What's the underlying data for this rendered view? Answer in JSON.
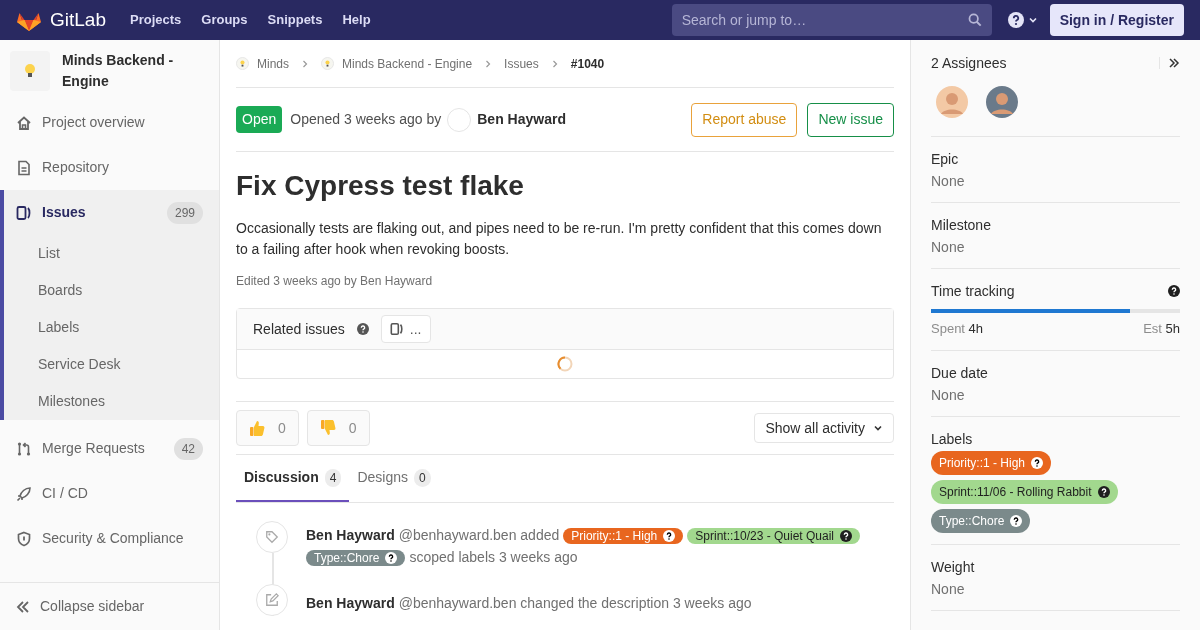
{
  "top_nav": {
    "brand": "GitLab",
    "links": [
      "Projects",
      "Groups",
      "Snippets",
      "Help"
    ],
    "search": {
      "placeholder": "Search or jump to…"
    },
    "sign_in": "Sign in / Register"
  },
  "sidebar": {
    "project": "Minds Backend - Engine",
    "items": [
      {
        "label": "Project overview",
        "selected": false
      },
      {
        "label": "Repository",
        "selected": false
      },
      {
        "label": "Issues",
        "count": "299",
        "selected": true,
        "children": [
          {
            "label": "List",
            "selected": false
          },
          {
            "label": "Boards",
            "selected": false
          },
          {
            "label": "Labels",
            "selected": false
          },
          {
            "label": "Service Desk",
            "selected": false
          },
          {
            "label": "Milestones",
            "selected": false
          }
        ]
      },
      {
        "label": "Merge Requests",
        "count": "42",
        "selected": false
      },
      {
        "label": "CI / CD",
        "selected": false
      },
      {
        "label": "Security & Compliance",
        "selected": false
      }
    ],
    "collapse": "Collapse sidebar"
  },
  "breadcrumb": [
    "Minds",
    "Minds Backend - Engine",
    "Issues",
    "#1040"
  ],
  "issue": {
    "status": "Open",
    "opened": "Opened 3 weeks ago by",
    "author": "Ben Hayward",
    "buttons": [
      {
        "label": "Report abuse",
        "kind": "warning"
      },
      {
        "label": "New issue",
        "kind": "success"
      }
    ],
    "title": "Fix Cypress test flake",
    "description": "Occasionally tests are flaking out, and pipes need to be re-run. I'm pretty confident that this comes down to a failing after hook when revoking boosts.",
    "edited": "Edited 3 weeks ago by Ben Hayward",
    "related_issues": {
      "title": "Related issues",
      "count": "..."
    },
    "awards": [
      {
        "kind": "thumbsup",
        "count": "0"
      },
      {
        "kind": "thumbsdown",
        "count": "0"
      }
    ],
    "activity_filter": "Show all activity",
    "tabs": [
      {
        "label": "Discussion",
        "count": "4",
        "selected": true
      },
      {
        "label": "Designs",
        "count": "0",
        "selected": false
      }
    ],
    "notes": [
      {
        "kind": "label",
        "author": "Ben Hayward",
        "action": "@benhayward.ben added",
        "labels": [
          {
            "text": "Priority::1 - High",
            "color": "#e8661f"
          },
          {
            "text": "Sprint::10/23 - Quiet Quail",
            "color": "#a2d88e"
          },
          {
            "text": "Type::Chore",
            "color": "#7b8a8b"
          }
        ],
        "suffix": "scoped labels 3 weeks ago"
      },
      {
        "kind": "edit",
        "author": "Ben Hayward",
        "action": "@benhayward.ben changed the description 3 weeks ago"
      }
    ]
  },
  "right_sidebar": {
    "assignees_title": "2 Assignees",
    "sections": [
      {
        "kind": "text",
        "title": "Epic",
        "value": "None"
      },
      {
        "kind": "text",
        "title": "Milestone",
        "value": "None"
      },
      {
        "kind": "time",
        "title": "Time tracking",
        "level": 0.8,
        "spent_label": "Spent",
        "spent": "4h",
        "est_label": "Est",
        "est": "5h"
      },
      {
        "kind": "text",
        "title": "Due date",
        "value": "None"
      },
      {
        "kind": "labels",
        "title": "Labels",
        "labels": [
          {
            "text": "Priority::1 - High",
            "color": "#e8661f"
          },
          {
            "text": "Sprint::11/06 - Rolling Rabbit",
            "color": "#a2d88e"
          },
          {
            "text": "Type::Chore",
            "color": "#7b8a8b"
          }
        ]
      },
      {
        "kind": "text",
        "title": "Weight",
        "value": "None"
      }
    ]
  }
}
